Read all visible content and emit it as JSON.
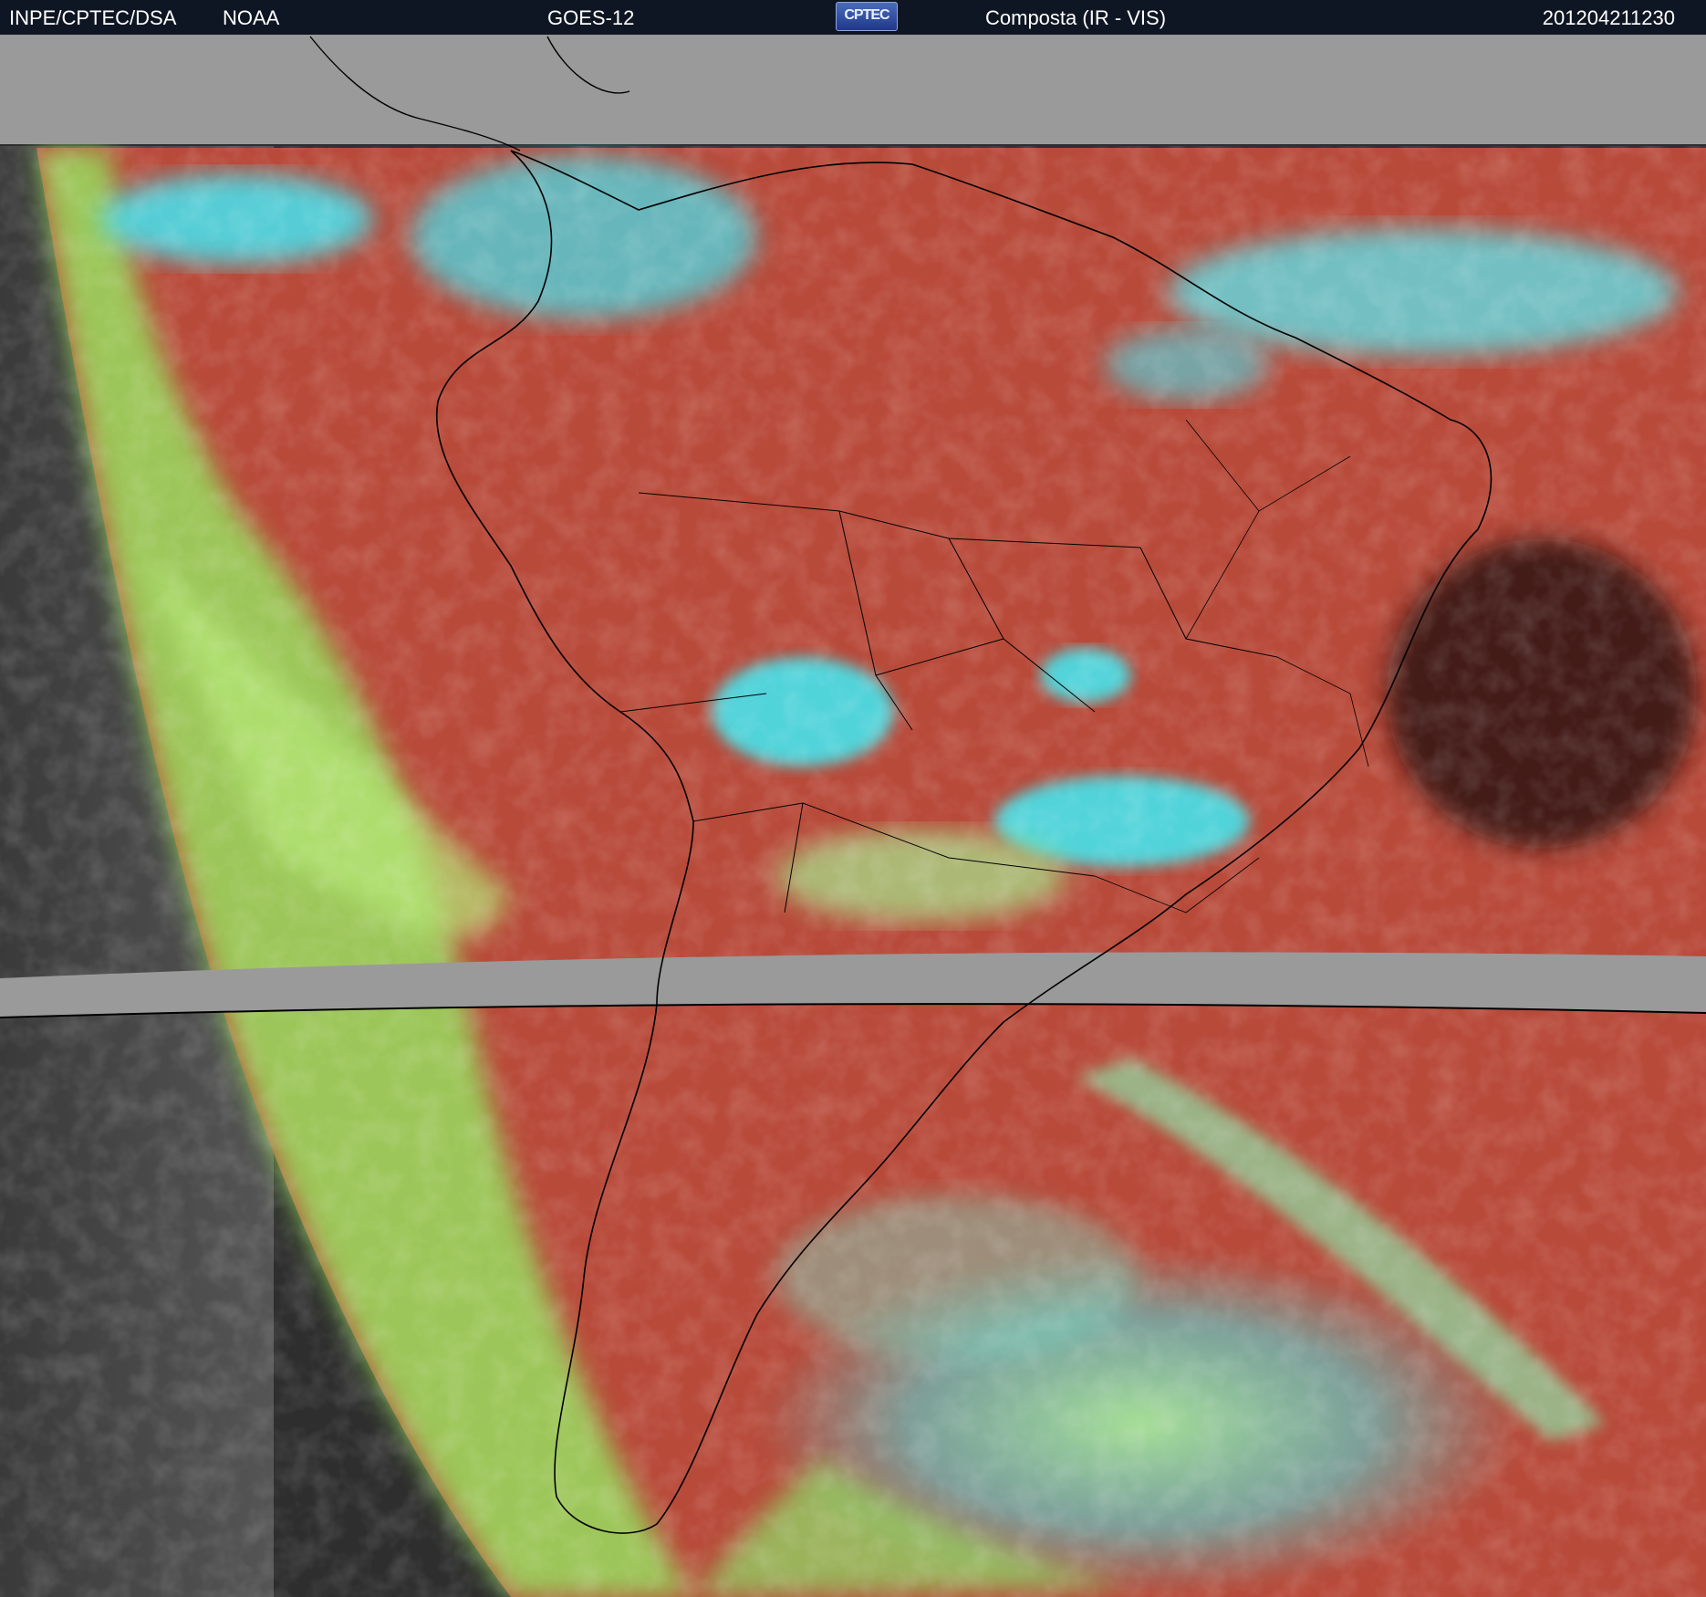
{
  "header": {
    "org": "INPE/CPTEC/DSA",
    "agency": "NOAA",
    "satellite": "GOES-12",
    "logo_text": "CPTEC",
    "product": "Composta (IR - VIS)",
    "timestamp": "201204211230"
  },
  "colors": {
    "header_bg": "#0f1623",
    "header_text": "#ffffff",
    "nodata_band": "#9a9a9a",
    "land_red": "#b84a3a",
    "cloud_cyan": "#3fe8f0",
    "low_cloud_green": "#9ee860",
    "space_gray": "#3a3a3a",
    "outline": "#000000"
  }
}
